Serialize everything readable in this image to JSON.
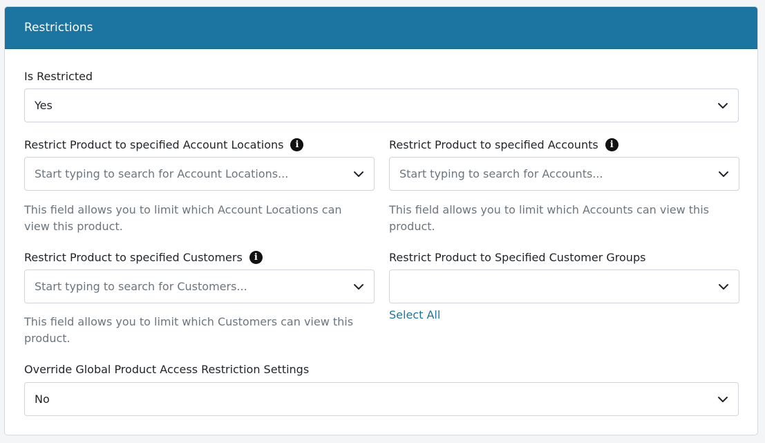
{
  "panel": {
    "title": "Restrictions",
    "header_color": "#1b75a0"
  },
  "is_restricted": {
    "label": "Is Restricted",
    "value": "Yes"
  },
  "account_locations": {
    "label": "Restrict Product to specified Account Locations",
    "placeholder": "Start typing to search for Account Locations...",
    "help": "This field allows you to limit which Account Locations can view this product."
  },
  "accounts": {
    "label": "Restrict Product to specified Accounts",
    "placeholder": "Start typing to search for Accounts...",
    "help": "This field allows you to limit which Accounts can view this product."
  },
  "customers": {
    "label": "Restrict Product to specified Customers",
    "placeholder": "Start typing to search for Customers...",
    "help": "This field allows you to limit which Customers can view this product."
  },
  "customer_groups": {
    "label": "Restrict Product to Specified Customer Groups",
    "value": "",
    "select_all": "Select All"
  },
  "override": {
    "label": "Override Global Product Access Restriction Settings",
    "value": "No"
  },
  "icons": {
    "info": "info-icon",
    "dropdown": "chevron-down-icon"
  }
}
